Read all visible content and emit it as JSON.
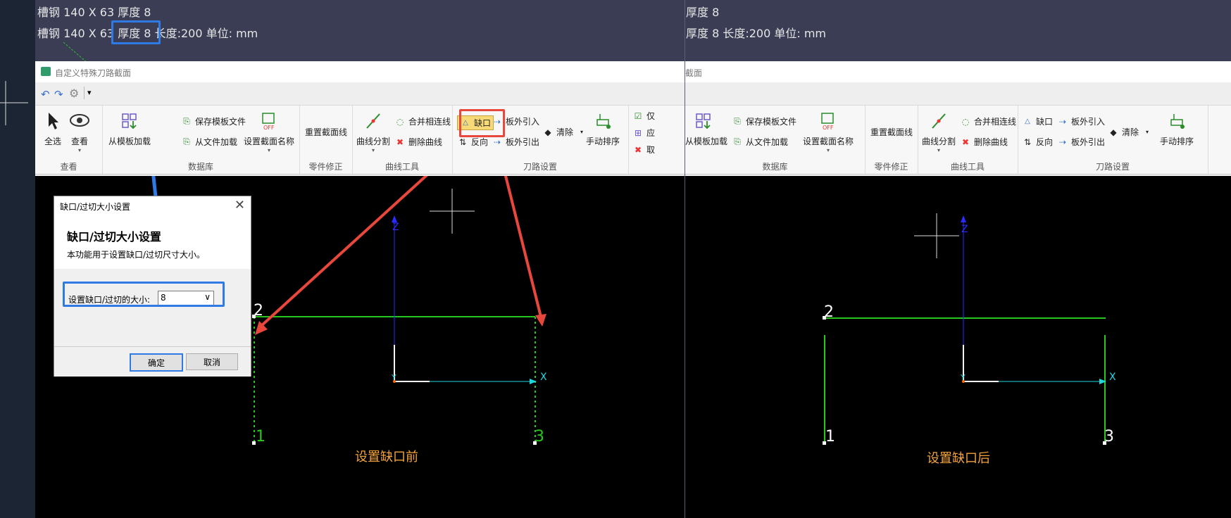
{
  "cad_text": {
    "left_line1": "槽钢 140 X 63 厚度 8",
    "left_line2_a": "槽钢 140 X 63 ",
    "left_line2_highlight": "厚度 8",
    "left_line2_b": " 长度:200 单位: mm",
    "right_line1": "厚度 8",
    "right_line2": "厚度 8 长度:200 单位: mm"
  },
  "window": {
    "title_left": "自定义特殊刀路截面",
    "title_right": "截面"
  },
  "ribbon": {
    "select_all": "全选",
    "view": "查看",
    "group_view": "查看",
    "load_template": "从模板加载",
    "load_template_right": "从模板加载",
    "save_template": "保存模板文件",
    "load_file": "从文件加载",
    "set_section_name": "设置截面名称",
    "group_database": "数据库",
    "reset_section_line": "重置截面线",
    "group_part_fix": "零件修正",
    "curve_split": "曲线分割",
    "merge_lines": "合并相连线",
    "delete_curve": "删除曲线",
    "group_curve_tools": "曲线工具",
    "notch": "缺口",
    "reverse": "反向",
    "lead_in": "板外引入",
    "lead_out": "板外引出",
    "clear": "清除",
    "group_toolpath": "刀路设置",
    "manual_sort": "手动排序",
    "cut_off_1": "仅",
    "cut_off_2": "应",
    "cut_off_3": "取"
  },
  "dialog": {
    "title": "缺口/过切大小设置",
    "heading": "缺口/过切大小设置",
    "description": "本功能用于设置缺口/过切尺寸大小。",
    "field_label": "设置缺口/过切的大小:",
    "field_value": "8",
    "ok_button": "确定",
    "cancel_button": "取消"
  },
  "canvas": {
    "axis_z": "Z",
    "axis_x": "X",
    "axis_y": "Y",
    "point_1": "1",
    "point_2": "2",
    "point_3": "3",
    "caption_before": "设置缺口前",
    "caption_after": "设置缺口后"
  },
  "colors": {
    "highlight_blue": "#2f7ae5",
    "highlight_red": "#e8473c",
    "profile_green": "#27c81a",
    "caption_orange": "#f4a33a",
    "axis_blue": "#2b2bff",
    "axis_cyan": "#1fd7e0"
  }
}
